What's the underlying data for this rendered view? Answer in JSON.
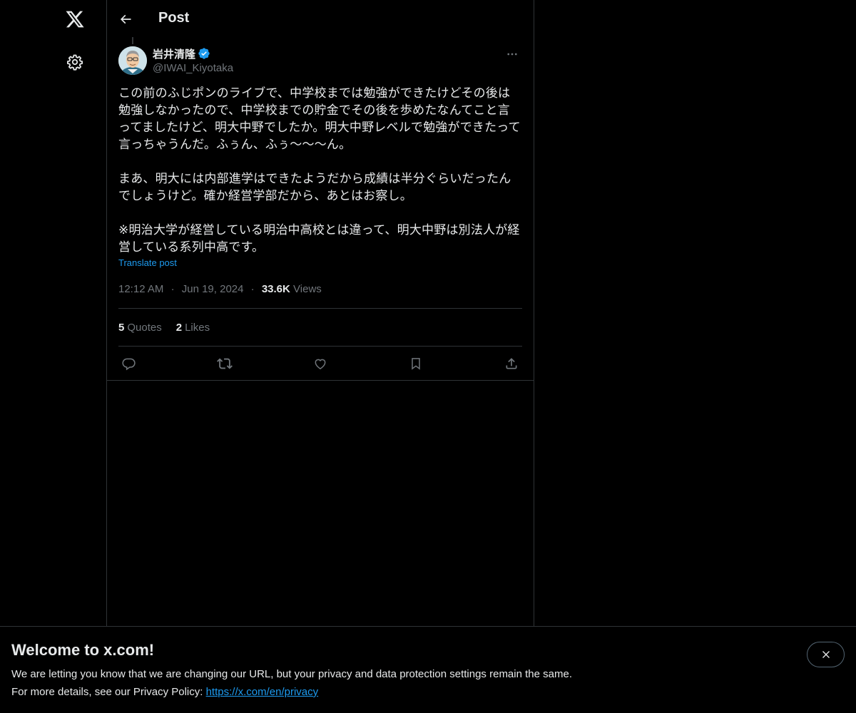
{
  "nav": {
    "logo_icon": "x-logo-icon",
    "settings_icon": "gear-icon"
  },
  "header": {
    "back_icon": "arrow-left-icon",
    "title": "Post"
  },
  "post": {
    "author": {
      "display_name": "岩井清隆",
      "handle": "@IWAI_Kiyotaka",
      "verified": true,
      "verified_color": "#1d9bf0"
    },
    "more_icon": "more-horizontal-icon",
    "body": "この前のふじポンのライブで、中学校までは勉強ができたけどその後は勉強しなかったので、中学校までの貯金でその後を歩めたなんてこと言ってましたけど、明大中野でしたか。明大中野レベルで勉強ができたって言っちゃうんだ。ふぅん、ふぅ〜〜〜ん。\n\nまあ、明大には内部進学はできたようだから成績は半分ぐらいだったんでしょうけど。確か経営学部だから、あとはお察し。\n\n※明治大学が経営している明治中高校とは違って、明大中野は別法人が経営している系列中高です。",
    "translate_label": "Translate post",
    "time": "12:12 AM",
    "date": "Jun 19, 2024",
    "views_count": "33.6K",
    "views_label": "Views",
    "stats": {
      "quotes_count": "5",
      "quotes_label": "Quotes",
      "likes_count": "2",
      "likes_label": "Likes"
    },
    "actions": [
      "reply-icon",
      "repost-icon",
      "like-icon",
      "bookmark-icon",
      "share-icon"
    ]
  },
  "banner": {
    "title": "Welcome to x.com!",
    "line1": "We are letting you know that we are changing our URL, but your privacy and data protection settings remain the same.",
    "line2_prefix": "For more details, see our Privacy Policy: ",
    "link_text": "https://x.com/en/privacy",
    "close_icon": "close-icon"
  },
  "colors": {
    "background": "#000000",
    "text_primary": "#e7e9ea",
    "text_secondary": "#71767b",
    "accent": "#1d9bf0",
    "border": "#2f3336"
  }
}
